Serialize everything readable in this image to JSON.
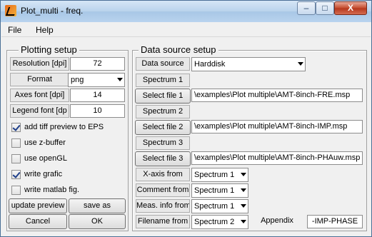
{
  "window": {
    "title": "Plot_multi - freq.",
    "min": "–",
    "max": "□",
    "close": "X"
  },
  "menu": [
    "File",
    "Help"
  ],
  "plotting": {
    "title": "Plotting setup",
    "resolution_label": "Resolution [dpi]",
    "resolution_value": "72",
    "format_label": "Format",
    "format_value": "png",
    "axes_font_label": "Axes font [dpi]",
    "axes_font_value": "14",
    "legend_font_label": "Legend font [dp",
    "legend_font_value": "10",
    "checkboxes": [
      {
        "label": "add tiff preview to EPS",
        "checked": true
      },
      {
        "label": "use z-buffer",
        "checked": false
      },
      {
        "label": "use openGL",
        "checked": false
      },
      {
        "label": "write grafic",
        "checked": true
      },
      {
        "label": "write matlab fig.",
        "checked": false
      }
    ],
    "update_preview": "update preview",
    "save_as": "save as",
    "cancel": "Cancel",
    "ok": "OK"
  },
  "source": {
    "title": "Data source setup",
    "data_source_label": "Data source",
    "data_source_value": "Harddisk",
    "spectra": [
      {
        "header": "Spectrum 1",
        "button": "Select file 1",
        "path": "\\examples\\Plot multiple\\AMT-8inch-FRE.msp"
      },
      {
        "header": "Spectrum 2",
        "button": "Select file 2",
        "path": "\\examples\\Plot multiple\\AMT-8inch-IMP.msp"
      },
      {
        "header": "Spectrum 3",
        "button": "Select file 3",
        "path": "\\examples\\Plot multiple\\AMT-8inch-PHAuw.msp"
      }
    ],
    "xaxis_label": "X-axis from",
    "xaxis_value": "Spectrum 1",
    "comment_label": "Comment from",
    "comment_value": "Spectrum 1",
    "meas_label": "Meas. info from",
    "meas_value": "Spectrum 1",
    "filename_label": "Filename from",
    "filename_value": "Spectrum 2",
    "appendix_label": "Appendix",
    "appendix_value": "-IMP-PHASE"
  }
}
